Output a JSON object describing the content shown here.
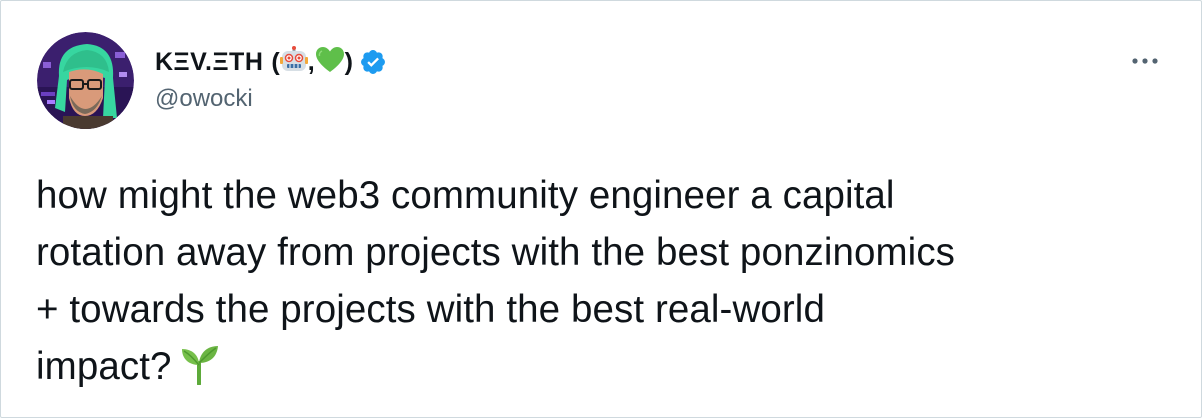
{
  "author": {
    "display_name": "KΞV.ΞTH",
    "open_paren": "(",
    "separator": ",",
    "close_paren": ")",
    "name_emojis": [
      "robot-face",
      "green-heart"
    ],
    "verified": true,
    "handle": "@owocki"
  },
  "tweet": {
    "lines": [
      "how might the web3 community engineer a capital",
      "rotation away from projects with the best ponzinomics",
      "+ towards the projects with the best real-world",
      "impact?"
    ],
    "trailing_emoji": "seedling"
  },
  "colors": {
    "text": "#0f1419",
    "secondary": "#536471",
    "verified_blue": "#1d9bf0",
    "border": "#cfd9de"
  },
  "icons": {
    "more": "more-horizontal-icon",
    "verified": "verified-badge-icon"
  }
}
